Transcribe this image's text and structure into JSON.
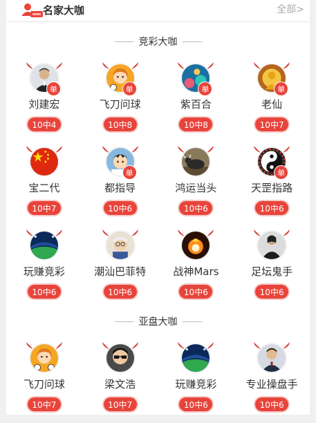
{
  "header": {
    "title": "名家大咖",
    "more": "全部>"
  },
  "sections": [
    {
      "title": "竞彩大咖",
      "experts": [
        {
          "name": "刘建宏",
          "record": "10中4",
          "badge": "单",
          "avatar": "man-suit"
        },
        {
          "name": "飞刀问球",
          "record": "10中8",
          "badge": "单",
          "avatar": "cartoon-girl"
        },
        {
          "name": "紫百合",
          "record": "10中8",
          "badge": "单",
          "avatar": "coral-scene"
        },
        {
          "name": "老仙",
          "record": "10中7",
          "badge": "单",
          "avatar": "golden-deity"
        },
        {
          "name": "宝二代",
          "record": "10中7",
          "badge": "",
          "avatar": "flag"
        },
        {
          "name": "都指导",
          "record": "10中6",
          "badge": "单",
          "avatar": "anime-boy"
        },
        {
          "name": "鸿运当头",
          "record": "10中6",
          "badge": "",
          "avatar": "bull"
        },
        {
          "name": "天罡指路",
          "record": "10中6",
          "badge": "单",
          "avatar": "taiji"
        },
        {
          "name": "玩赚竞彩",
          "record": "10中6",
          "badge": "",
          "avatar": "stadium"
        },
        {
          "name": "潮汕巴菲特",
          "record": "10中6",
          "badge": "",
          "avatar": "old-man"
        },
        {
          "name": "战神Mars",
          "record": "10中6",
          "badge": "",
          "avatar": "fire-ball"
        },
        {
          "name": "足坛鬼手",
          "record": "10中6",
          "badge": "",
          "avatar": "dark-figure"
        }
      ]
    },
    {
      "title": "亚盘大咖",
      "experts": [
        {
          "name": "飞刀问球",
          "record": "10中7",
          "badge": "",
          "avatar": "cartoon-girl"
        },
        {
          "name": "梁文浩",
          "record": "10中7",
          "badge": "",
          "avatar": "sunglasses-man"
        },
        {
          "name": "玩赚竞彩",
          "record": "10中6",
          "badge": "",
          "avatar": "stadium"
        },
        {
          "name": "专业操盘手",
          "record": "10中6",
          "badge": "",
          "avatar": "businessman"
        }
      ]
    }
  ]
}
